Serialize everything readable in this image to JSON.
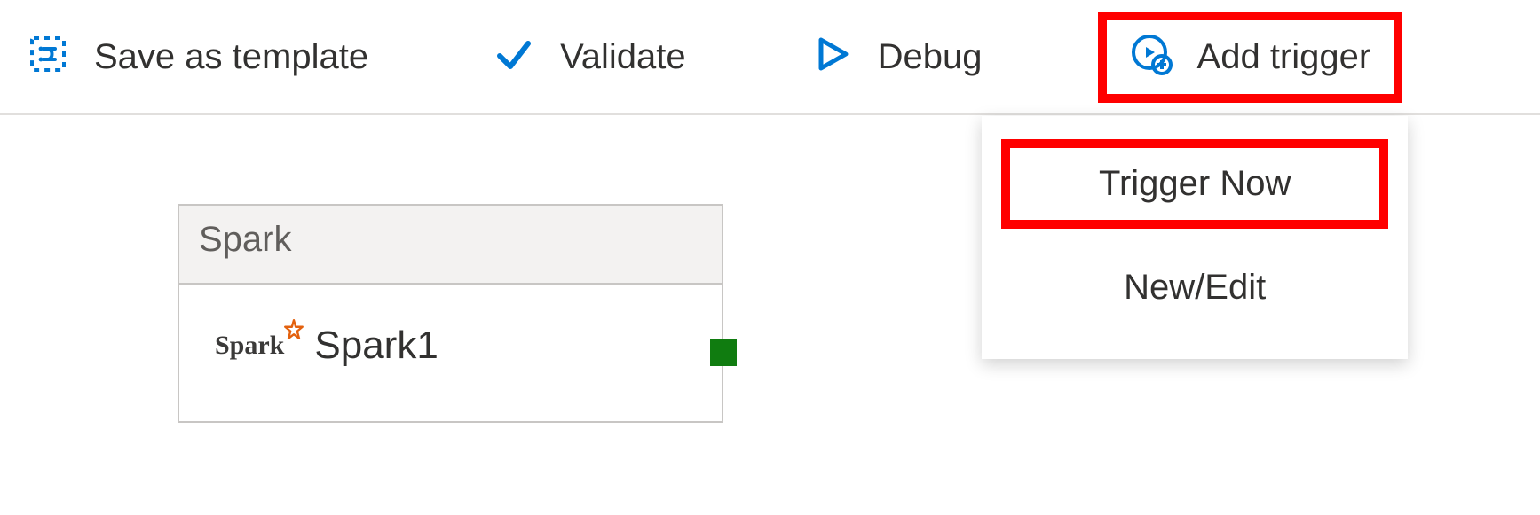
{
  "toolbar": {
    "save_template_label": "Save as template",
    "validate_label": "Validate",
    "debug_label": "Debug",
    "add_trigger_label": "Add trigger"
  },
  "trigger_menu": {
    "items": [
      {
        "label": "Trigger Now"
      },
      {
        "label": "New/Edit"
      }
    ]
  },
  "canvas": {
    "node": {
      "type_label": "Spark",
      "name": "Spark1",
      "logo_text": "Spark"
    }
  }
}
